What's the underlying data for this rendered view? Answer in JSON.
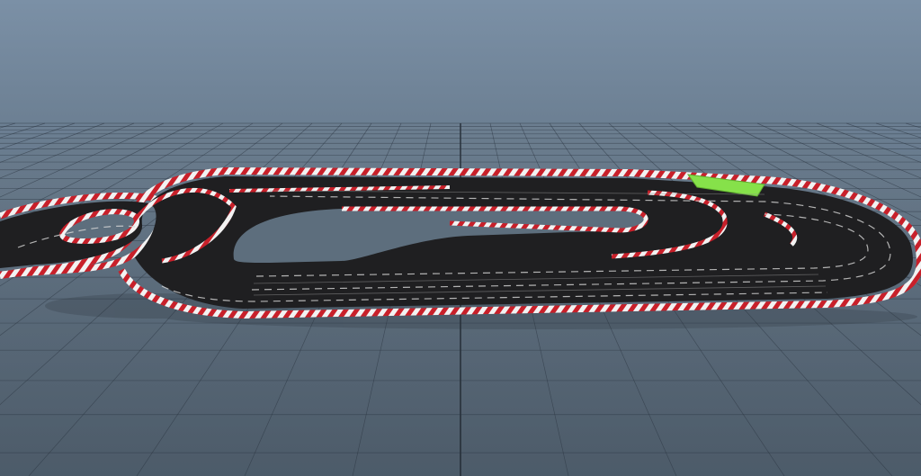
{
  "viewport": {
    "background_top": "#7b90a6",
    "background_bottom": "#4f5e6c",
    "grid_color": "#2a3440",
    "grid_axis_color": "#1c232b"
  },
  "track": {
    "asphalt_color": "#1f1f21",
    "lane_line_color": "#d8d8d8",
    "curb_red": "#c8202a",
    "curb_white": "#f2f2f2",
    "start_finish_color": "#86e14a"
  }
}
